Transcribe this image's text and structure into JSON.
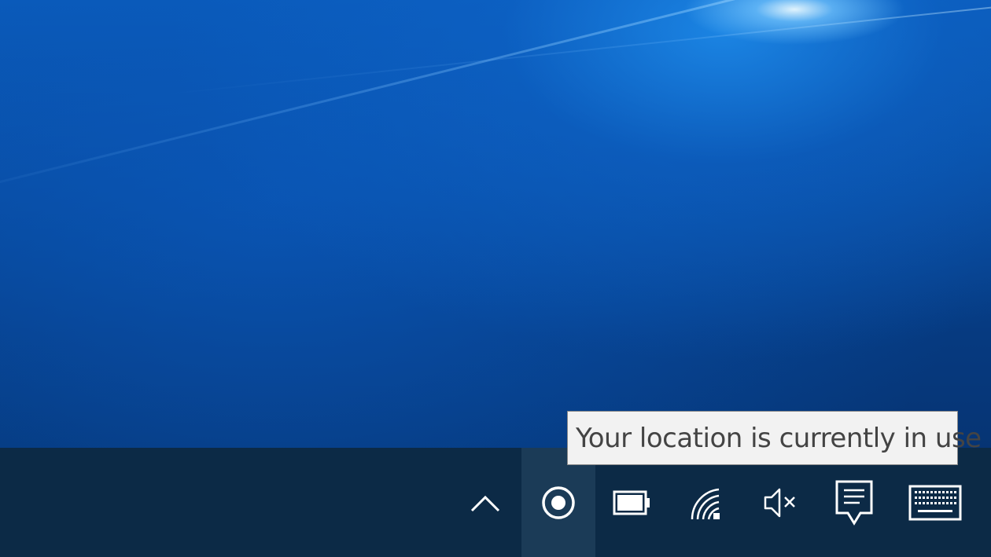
{
  "desktop": {
    "wallpaper": "windows-10-hero-blue",
    "colors": {
      "wallpaper_dark": "#052f68",
      "wallpaper_light": "#1e8cf0",
      "taskbar": "#0c2a46",
      "taskbar_active": "#1b3b57",
      "icon": "#ffffff",
      "tooltip_bg": "#f2f2f2",
      "tooltip_text": "#444444"
    }
  },
  "taskbar": {
    "tray_icons": [
      {
        "name": "show-hidden-icons",
        "icon": "chevron-up-icon",
        "active": false
      },
      {
        "name": "location-in-use",
        "icon": "location-icon",
        "active": true
      },
      {
        "name": "battery",
        "icon": "battery-icon",
        "active": false
      },
      {
        "name": "network",
        "icon": "wifi-icon",
        "active": false
      },
      {
        "name": "volume-muted",
        "icon": "speaker-muted-icon",
        "active": false
      },
      {
        "name": "action-center",
        "icon": "notification-icon",
        "active": false
      },
      {
        "name": "touch-keyboard",
        "icon": "keyboard-icon",
        "active": false
      }
    ]
  },
  "tooltip": {
    "text": "Your location is currently in use"
  }
}
